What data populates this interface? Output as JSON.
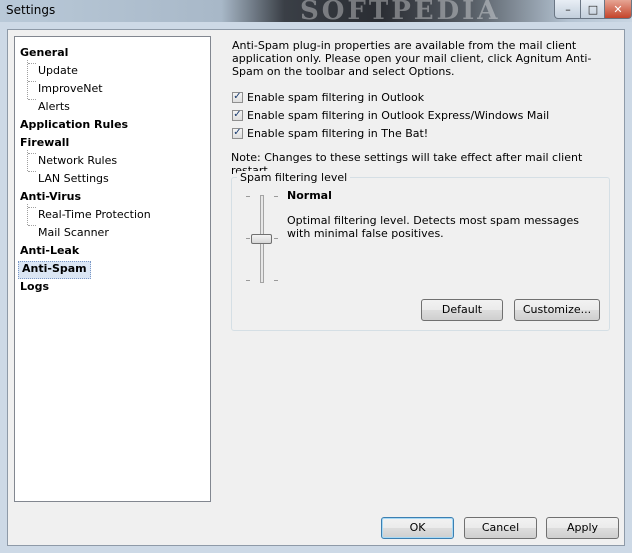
{
  "window": {
    "title": "Settings",
    "watermark": "SOFTPEDIA",
    "controls": {
      "minimize": "–",
      "maximize": "□",
      "close": "✕"
    }
  },
  "tree": {
    "items": [
      {
        "label": "General",
        "level": 0
      },
      {
        "label": "Update",
        "level": 1
      },
      {
        "label": "ImproveNet",
        "level": 1
      },
      {
        "label": "Alerts",
        "level": 1
      },
      {
        "label": "Application Rules",
        "level": 0
      },
      {
        "label": "Firewall",
        "level": 0
      },
      {
        "label": "Network Rules",
        "level": 1
      },
      {
        "label": "LAN Settings",
        "level": 1
      },
      {
        "label": "Anti-Virus",
        "level": 0
      },
      {
        "label": "Real-Time Protection",
        "level": 1
      },
      {
        "label": "Mail Scanner",
        "level": 1
      },
      {
        "label": "Anti-Leak",
        "level": 0
      },
      {
        "label": "Anti-Spam",
        "level": 0,
        "selected": true
      },
      {
        "label": "Logs",
        "level": 0
      }
    ]
  },
  "panel": {
    "info": "Anti-Spam plug-in properties are available from the mail client application only. Please open your mail client, click Agnitum Anti-Spam on the toolbar and select Options.",
    "checkboxes": [
      {
        "label": "Enable spam filtering in Outlook",
        "checked": true
      },
      {
        "label": "Enable spam filtering in Outlook Express/Windows Mail",
        "checked": true
      },
      {
        "label": "Enable spam filtering in The Bat!",
        "checked": true
      }
    ],
    "check_mark": "✓",
    "note": "Note: Changes to these settings will take effect after mail client restart.",
    "group": {
      "label": "Spam filtering level",
      "level_name": "Normal",
      "level_description": "Optimal filtering level. Detects most spam messages with minimal false positives.",
      "default_button": "Default",
      "customize_button": "Customize..."
    }
  },
  "footer": {
    "ok": "OK",
    "cancel": "Cancel",
    "apply": "Apply"
  }
}
